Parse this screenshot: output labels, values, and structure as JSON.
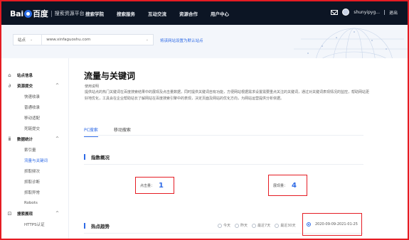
{
  "topbar": {
    "logo_text_left": "Bai",
    "logo_text_right": "百度",
    "logo_sub": "搜索资源平台",
    "nav": [
      "搜索学院",
      "搜索服务",
      "互动交流",
      "资源合作",
      "用户中心"
    ],
    "username": "shunyipyg...",
    "logout": "退出"
  },
  "hero": {
    "site_type": "站点",
    "site_url": "www.xinfaguoshu.com",
    "set_default_link": "将该网站设置为默认站点"
  },
  "sidebar": {
    "groups": [
      {
        "icon": "home-icon",
        "label": "站点信息",
        "items": []
      },
      {
        "icon": "link-icon",
        "label": "资源提交",
        "items": [
          "快速收录",
          "普通收录",
          "移动适配",
          "死链提交"
        ]
      },
      {
        "icon": "chart-icon",
        "label": "数据统计",
        "items": [
          "索引量",
          "流量与关键词",
          "抓取频次",
          "抓取诊断",
          "抓取异常",
          "Robots"
        ]
      },
      {
        "icon": "shield-icon",
        "label": "搜索展现",
        "items": [
          "HTTPS认证"
        ]
      }
    ],
    "active_item": "流量与关键词"
  },
  "main": {
    "title": "流量与关键词",
    "help_title": "使用说明",
    "help_text": "提供站点的热门关键词在百度搜索结果中的展现及点击量数据，同时提供关键词自有功能，方便网站根据需求设置需要重点关注的关键词，通过对关键词表现情况的监控，帮助网站更好地优化，工具会在企业帮助站长了解网站在百度搜索引擎中的表现，决定页面及网站的优化方向，为网站运营提供分析依据。",
    "tabs": [
      "PC搜索",
      "移动搜索"
    ],
    "active_tab": "PC搜索",
    "overview_title": "指数概况",
    "clicks_label": "点击量：",
    "clicks_value": "1",
    "impressions_label": "展现量：",
    "impressions_value": "4",
    "trend_title": "热点趋势",
    "range_options": [
      "今天",
      "昨天",
      "最近7天",
      "最近30天"
    ],
    "range_custom": "2020-09-09-2021-01-25"
  },
  "colors": {
    "accent": "#2e6ae6",
    "highlight": "#e51c23",
    "topbar": "#0c1524"
  }
}
